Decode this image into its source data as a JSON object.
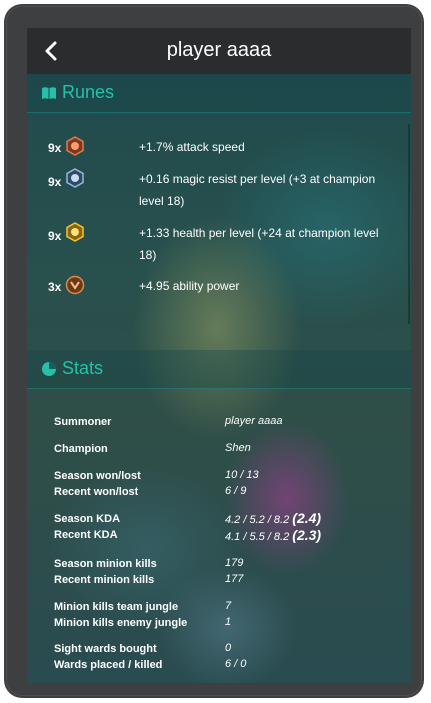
{
  "header": {
    "title": "player aaaa",
    "back_icon": "chevron-left-icon"
  },
  "runes_section": {
    "title": "Runes",
    "icon": "book-icon",
    "color": "#26c0a8",
    "items": [
      {
        "count": "9x",
        "icon": "mark-rune-icon",
        "text": "+1.7% attack speed"
      },
      {
        "count": "9x",
        "icon": "seal-rune-icon",
        "text": "+0.16 magic resist per level (+3 at champion level 18)"
      },
      {
        "count": "9x",
        "icon": "glyph-rune-icon",
        "text": "+1.33 health per level (+24 at champion level 18)"
      },
      {
        "count": "3x",
        "icon": "quintessence-rune-icon",
        "text": "+4.95 ability power"
      }
    ]
  },
  "stats_section": {
    "title": "Stats",
    "icon": "pie-chart-icon",
    "summoner_label": "Summoner",
    "summoner_value": "player aaaa",
    "champion_label": "Champion",
    "champion_value": "Shen",
    "season_wl_label": "Season won/lost",
    "season_wl_value": "10 / 13",
    "recent_wl_label": "Recent won/lost",
    "recent_wl_value": "6 / 9",
    "season_kda_label": "Season KDA",
    "season_kda_value": "4.2 / 5.2 / 8.2",
    "season_kda_ratio": "(2.4)",
    "recent_kda_label": "Recent KDA",
    "recent_kda_value": "4.1 / 5.5 / 8.2",
    "recent_kda_ratio": "(2.3)",
    "season_minion_label": "Season minion kills",
    "season_minion_value": "179",
    "recent_minion_label": "Recent minion kills",
    "recent_minion_value": "177",
    "team_jungle_label": "Minion kills team jungle",
    "team_jungle_value": "7",
    "enemy_jungle_label": "Minion kills enemy jungle",
    "enemy_jungle_value": "1",
    "sight_wards_label": "Sight wards bought",
    "sight_wards_value": "0",
    "wards_label": "Wards placed / killed",
    "wards_value": "6 / 0"
  }
}
